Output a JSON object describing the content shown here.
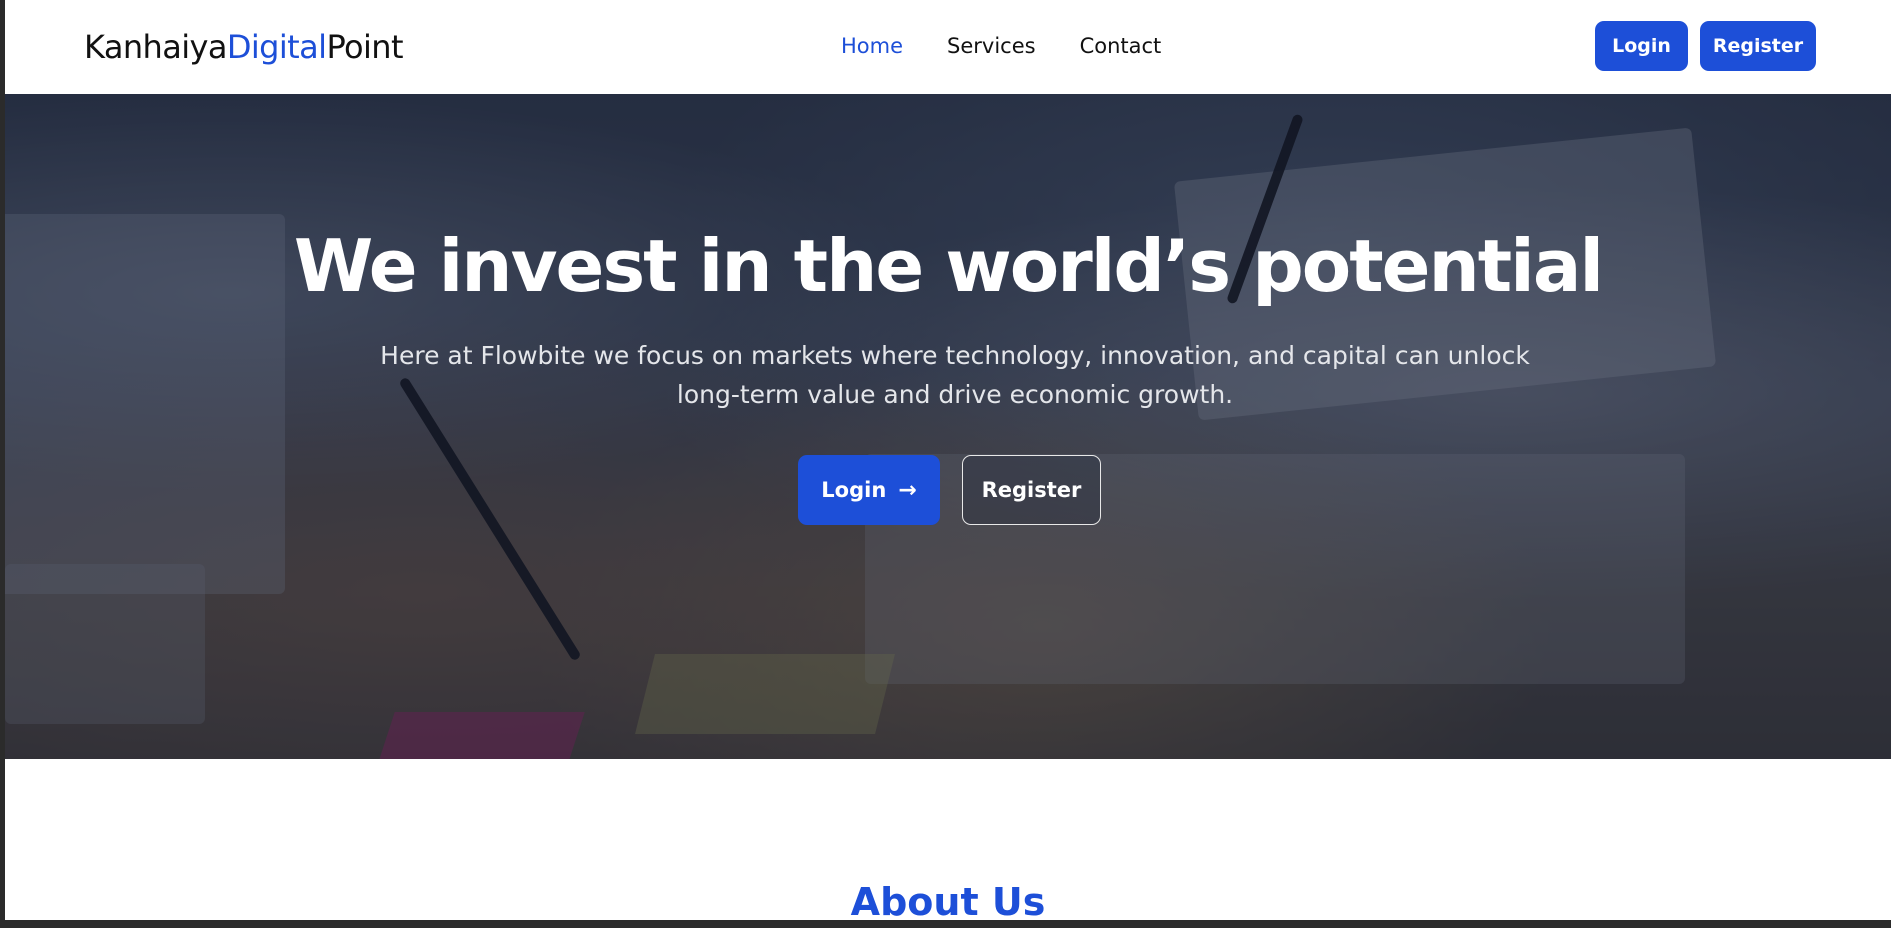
{
  "brand": {
    "part1": "Kanhaiya",
    "part2": "Digital",
    "part3": "Point",
    "accent_color": "#1d4fd8"
  },
  "nav": {
    "links": [
      {
        "label": "Home",
        "active": true
      },
      {
        "label": "Services",
        "active": false
      },
      {
        "label": "Contact",
        "active": false
      }
    ],
    "login_label": "Login",
    "register_label": "Register"
  },
  "hero": {
    "title": "We invest in the world’s potential",
    "subtitle": "Here at Flowbite we focus on markets where technology, innovation, and capital can unlock long-term value and drive economic growth.",
    "login_label": "Login",
    "login_icon": "arrow-right-icon",
    "login_arrow": "→",
    "register_label": "Register",
    "background_image": "business-meeting-photo"
  },
  "about": {
    "title": "About Us"
  }
}
